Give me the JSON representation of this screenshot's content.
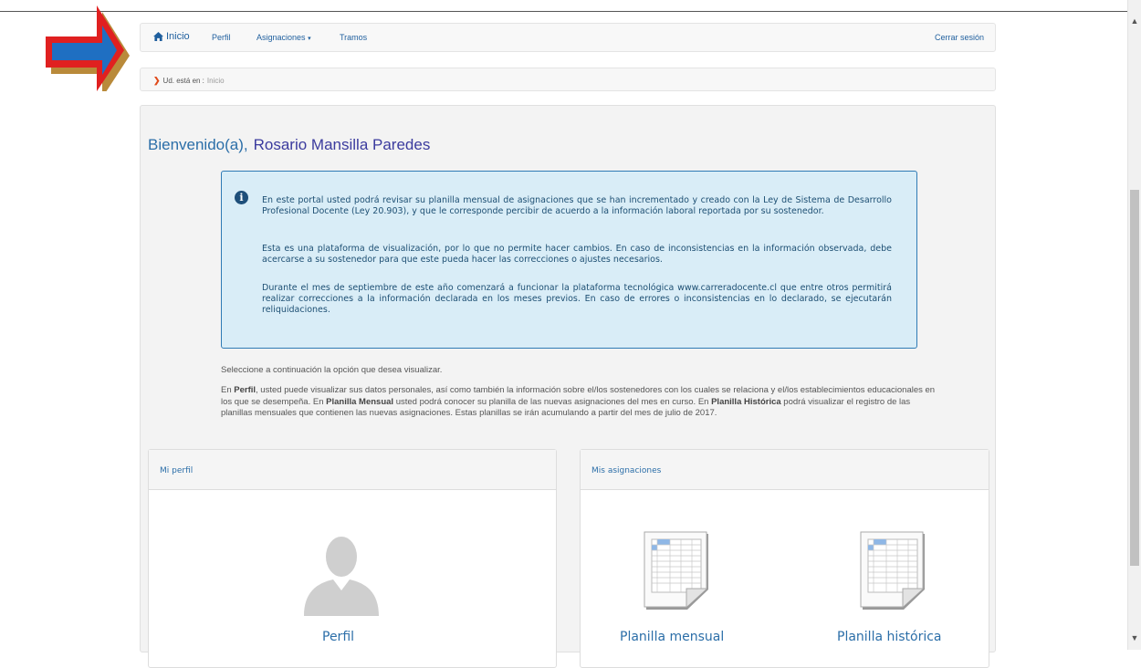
{
  "nav": {
    "home": "Inicio",
    "perfil": "Perfil",
    "asignaciones": "Asignaciones",
    "tramos": "Tramos",
    "logout": "Cerrar sesión"
  },
  "breadcrumb": {
    "prefix": "Ud. está en :",
    "current": "Inicio"
  },
  "welcome": {
    "greeting": "Bienvenido(a),",
    "name": "Rosario Mansilla Paredes"
  },
  "info": {
    "p1": "En este portal usted podrá revisar su planilla mensual de asignaciones que se han incrementado y creado con la Ley de Sistema de Desarrollo Profesional Docente (Ley 20.903), y que le corresponde percibir de acuerdo a la información laboral reportada por su sostenedor.",
    "p2": "Esta es una plataforma de visualización, por lo que no permite hacer cambios. En caso de inconsistencias en la información observada, debe acercarse a su sostenedor para que este pueda hacer las correcciones o ajustes necesarios.",
    "p3": "Durante el mes de septiembre de este año comenzará a funcionar la plataforma tecnológica www.carreradocente.cl que entre otros permitirá realizar correcciones a la información declarada en los meses previos. En caso de errores o inconsistencias en lo declarado, se ejecutarán reliquidaciones."
  },
  "select_prompt": "Seleccione a continuación la opción que desea visualizar.",
  "description": {
    "t1": "En ",
    "b1": "Perfil",
    "t2": ", usted puede visualizar sus datos personales, así como también la información sobre el/los sostenedores con los cuales se relaciona y el/los establecimientos educacionales en los que se desempeña. En ",
    "b2": "Planilla Mensual",
    "t3": " usted podrá conocer su planilla de las nuevas asignaciones del mes en curso. En ",
    "b3": "Planilla Histórica",
    "t4": " podrá visualizar el registro de las planillas mensuales que contienen las nuevas asignaciones. Estas planillas se irán acumulando a partir del mes de julio de 2017."
  },
  "panels": {
    "profile": {
      "title": "Mi perfil",
      "label": "Perfil"
    },
    "assignments": {
      "title": "Mis asignaciones",
      "monthly": "Planilla mensual",
      "history": "Planilla histórica"
    }
  },
  "colors": {
    "link": "#1f5f9e",
    "info_bg": "#d9edf7",
    "info_border": "#2f7bb5",
    "arrow_red": "#e02020",
    "arrow_blue": "#1f6fc2"
  }
}
